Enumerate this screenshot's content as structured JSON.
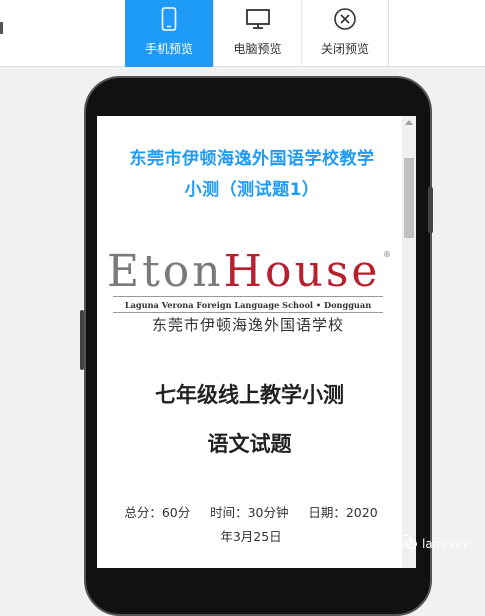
{
  "toolbar": {
    "buttons": [
      {
        "label": "手机预览",
        "icon": "mobile-icon",
        "active": true
      },
      {
        "label": "电脑预览",
        "icon": "monitor-icon",
        "active": false
      },
      {
        "label": "关闭预览",
        "icon": "close-circle-icon",
        "active": false
      }
    ]
  },
  "article": {
    "title_line1": "东莞市伊顿海逸外国语学校教学",
    "title_line2": "小测（测试题1）",
    "logo": {
      "brand_left": "Eton",
      "brand_right": "House",
      "registered": "®",
      "subtitle": "Laguna Verona Foreign Language School • Dongguan",
      "school_cn": "东莞市伊顿海逸外国语学校"
    },
    "heading1": "七年级线上教学小测",
    "heading2": "语文试题",
    "meta_line1": "总分：60分     时间：30分钟     日期：2020",
    "meta_line2": "年3月25日"
  },
  "watermark": {
    "text": "lamivvy"
  },
  "colors": {
    "accent": "#1e9bf6",
    "brand_red": "#b8202e",
    "brand_grey": "#7a7a7a"
  }
}
